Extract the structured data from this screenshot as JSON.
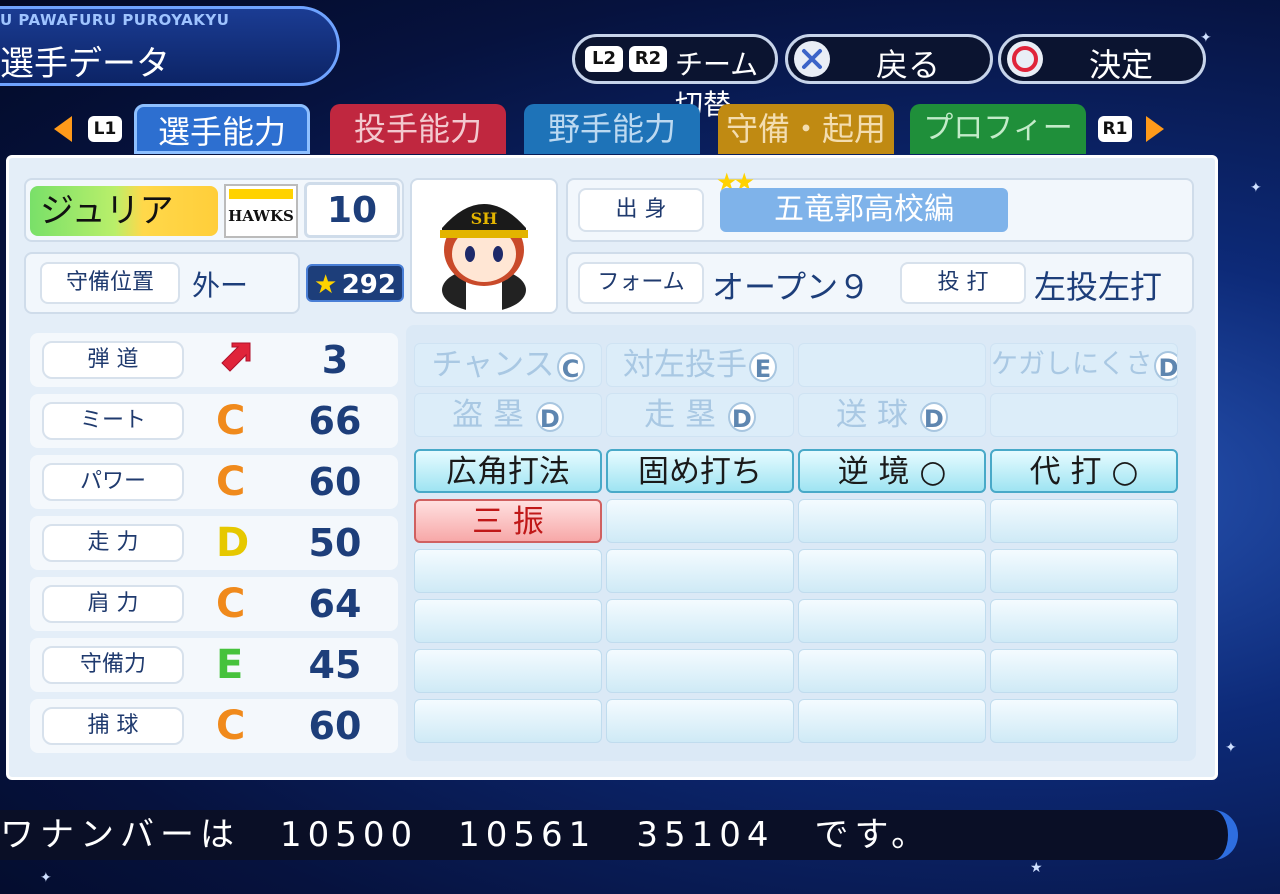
{
  "header": {
    "app_name": "U PAWAFURU PUROYAKYU",
    "page_title": "選手データ",
    "team_switch": {
      "l2": "L2",
      "r2": "R2",
      "label": "チーム切替"
    },
    "back": {
      "label": "戻る"
    },
    "confirm": {
      "label": "決定"
    }
  },
  "tabs": {
    "l1": "L1",
    "r1": "R1",
    "items": [
      {
        "label": "選手能力",
        "color": "#1f5fc0"
      },
      {
        "label": "投手能力",
        "color": "#c0273f"
      },
      {
        "label": "野手能力",
        "color": "#1e73b8"
      },
      {
        "label": "守備・起用",
        "color": "#c08a12"
      },
      {
        "label": "プロフィール",
        "color": "#1f8f3a"
      }
    ]
  },
  "player": {
    "name": "ジュリア",
    "team_logo_text": "HAWKS",
    "number": "10",
    "position_label": "守備位置",
    "position": "外ー",
    "rating": "292",
    "origin_label": "出 身",
    "origin": "五竜郭高校編",
    "origin_stars": "★★",
    "form_label": "フォーム",
    "form": "オープン９",
    "throw_bat_label": "投 打",
    "throw_bat": "左投左打"
  },
  "stats": [
    {
      "label": "弾 道",
      "grade": "↗",
      "value": "3",
      "color": "#e0243a"
    },
    {
      "label": "ミート",
      "grade": "C",
      "value": "66",
      "color": "#f08a1c"
    },
    {
      "label": "パワー",
      "grade": "C",
      "value": "60",
      "color": "#f08a1c"
    },
    {
      "label": "走 力",
      "grade": "D",
      "value": "50",
      "color": "#e6c800"
    },
    {
      "label": "肩 力",
      "grade": "C",
      "value": "64",
      "color": "#f08a1c"
    },
    {
      "label": "守備力",
      "grade": "E",
      "value": "45",
      "color": "#46c23c"
    },
    {
      "label": "捕 球",
      "grade": "C",
      "value": "60",
      "color": "#f08a1c"
    }
  ],
  "abilities": {
    "row1": [
      {
        "text": "チャンス",
        "grade": "C"
      },
      {
        "text": "対左投手",
        "grade": "E"
      },
      {
        "text": "",
        "grade": ""
      },
      {
        "text": "ケガしにくさ",
        "grade": "D"
      }
    ],
    "row2": [
      {
        "text": "盗 塁",
        "grade": "D"
      },
      {
        "text": "走 塁",
        "grade": "D"
      },
      {
        "text": "送 球",
        "grade": "D"
      },
      {
        "text": "",
        "grade": ""
      }
    ],
    "row3": [
      "広角打法",
      "固め打ち",
      "逆 境 ○",
      "代 打 ○"
    ],
    "row4": [
      "三 振"
    ]
  },
  "footer": {
    "message": "ワナンバーは　10500　10561　35104　です。"
  }
}
